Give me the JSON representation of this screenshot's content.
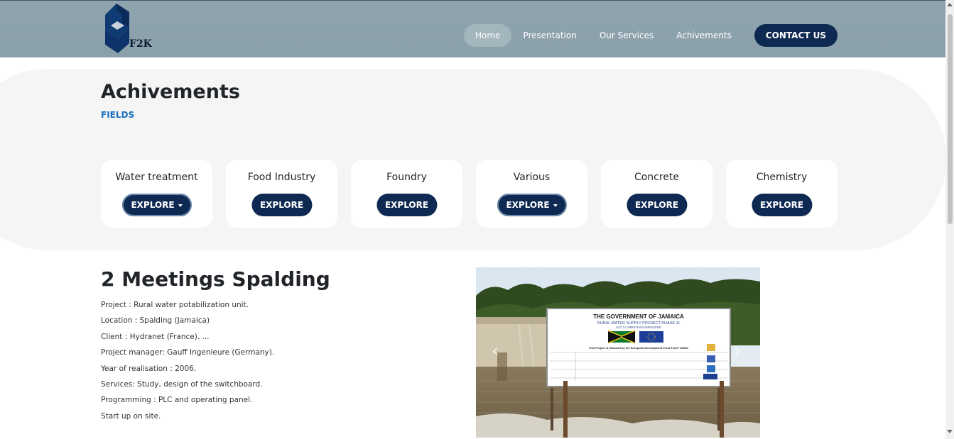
{
  "header": {
    "logo_text": "F2K",
    "nav": [
      "Home",
      "Presentation",
      "Our Services",
      "Achivements"
    ],
    "contact_label": "CONTACT US"
  },
  "section": {
    "title": "Achivements",
    "subtitle": "FIELDS"
  },
  "fields": [
    {
      "title": "Water treatment",
      "button": "EXPLORE",
      "dropdown": true
    },
    {
      "title": "Food Industry",
      "button": "EXPLORE",
      "dropdown": false
    },
    {
      "title": "Foundry",
      "button": "EXPLORE",
      "dropdown": false
    },
    {
      "title": "Various",
      "button": "EXPLORE",
      "dropdown": true
    },
    {
      "title": "Concrete",
      "button": "EXPLORE",
      "dropdown": false
    },
    {
      "title": "Chemistry",
      "button": "EXPLORE",
      "dropdown": false
    }
  ],
  "project": {
    "title": "2 Meetings Spalding",
    "lines": [
      "Project : Rural water potabilization unit.",
      "Location : Spalding (Jamaica)",
      "Client : Hydranet (France). ...",
      "Project manager: Gauff Ingenieure (Germany).",
      "Year of realisation : 2006.",
      "Services: Study, design of the switchboard.",
      "Programming : PLC and operating panel.",
      "Start up on site."
    ]
  },
  "photo_sign": {
    "title": "THE GOVERNMENT OF JAMAICA",
    "line1": "RURAL WATER SUPPLY PROJECT-PHASE 11",
    "line2": "LOT 3 CHRISTIANA/SPALDING",
    "line3": "This Project is financed by the European Development Fund 9 ACP JM011"
  },
  "colors": {
    "header_bg": "#8ea3ad",
    "brand_navy": "#0f2a52",
    "link_blue": "#1a6fc0",
    "band_bg": "#f5f5f5"
  }
}
